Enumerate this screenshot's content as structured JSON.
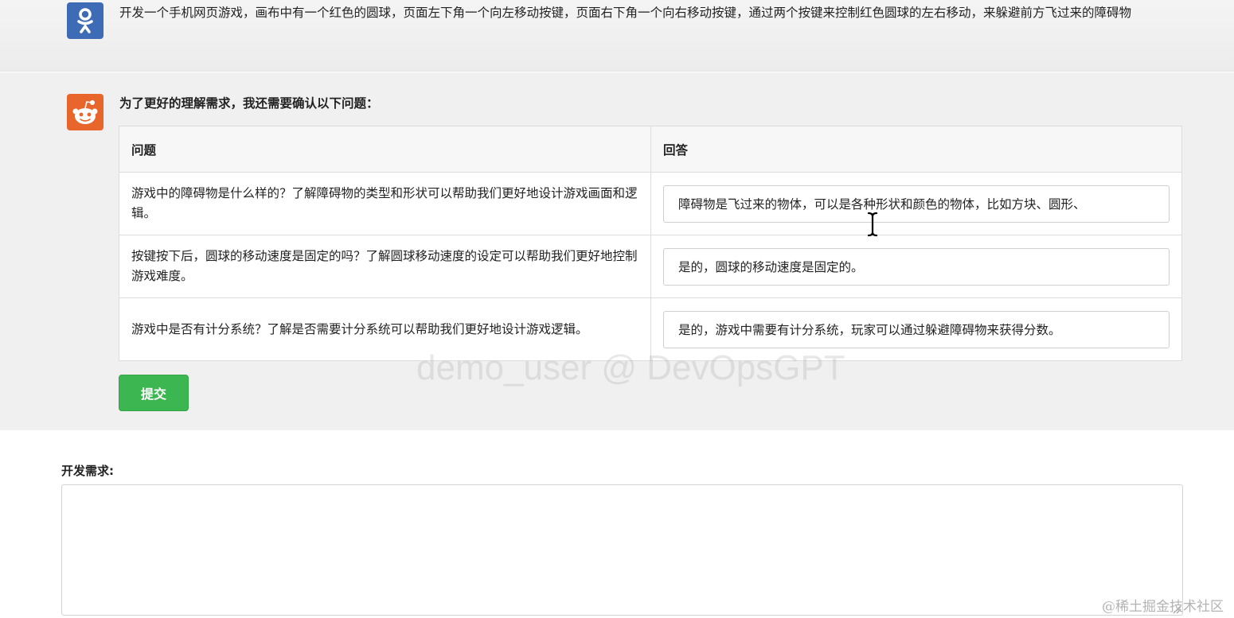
{
  "user_message": {
    "avatar_icon": "odnoklassniki-icon",
    "avatar_color": "#3d6bb5",
    "text": "开发一个手机网页游戏，画布中有一个红色的圆球，页面左下角一个向左移动按键，页面右下角一个向右移动按键，通过两个按键来控制红色圆球的左右移动，来躲避前方飞过来的障碍物"
  },
  "bot_message": {
    "avatar_icon": "reddit-icon",
    "avatar_color": "#e8652c",
    "title": "为了更好的理解需求，我还需要确认以下问题：",
    "table": {
      "headers": {
        "question": "问题",
        "answer": "回答"
      },
      "rows": [
        {
          "question": "游戏中的障碍物是什么样的？了解障碍物的类型和形状可以帮助我们更好地设计游戏画面和逻辑。",
          "answer": "障碍物是飞过来的物体，可以是各种形状和颜色的物体，比如方块、圆形、"
        },
        {
          "question": "按键按下后，圆球的移动速度是固定的吗？了解圆球移动速度的设定可以帮助我们更好地控制游戏难度。",
          "answer": "是的，圆球的移动速度是固定的。"
        },
        {
          "question": "游戏中是否有计分系统？了解是否需要计分系统可以帮助我们更好地设计游戏逻辑。",
          "answer": "是的，游戏中需要有计分系统，玩家可以通过躲避障碍物来获得分数。"
        }
      ]
    },
    "submit_label": "提交",
    "submit_color": "#3cb650"
  },
  "watermark": "demo_user @ DevOpsGPT",
  "requirement": {
    "label": "开发需求:",
    "value": ""
  },
  "site_mark": "@稀土掘金技术社区"
}
